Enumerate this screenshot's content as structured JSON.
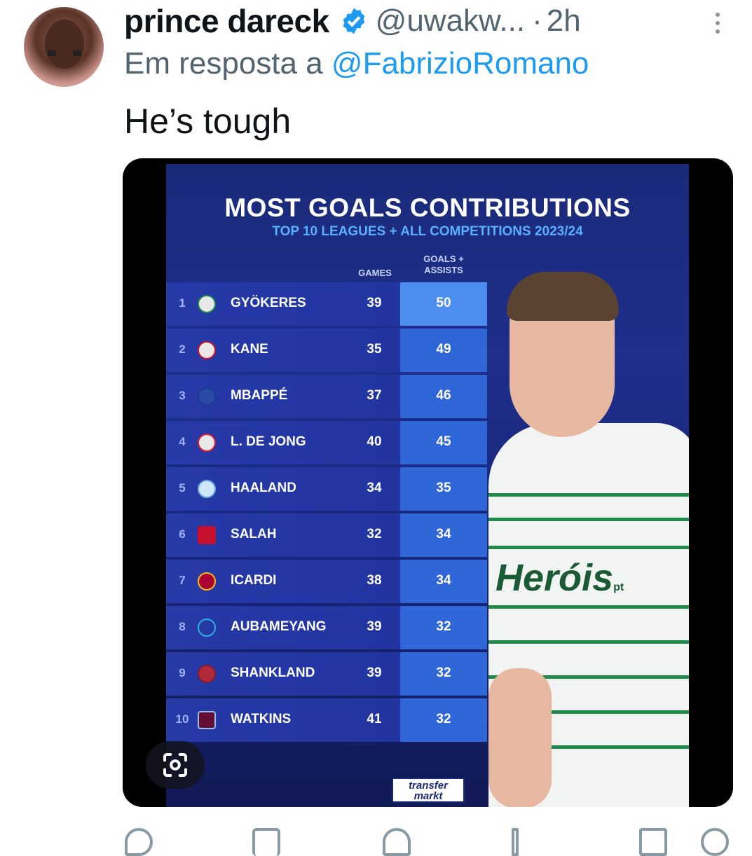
{
  "tweet": {
    "author_name": "prince dareck",
    "handle": "@uwakw...",
    "separator": "·",
    "time": "2h",
    "reply_prefix": "Em resposta a",
    "reply_to": "@FabrizioRomano",
    "text": "He’s tough"
  },
  "graphic": {
    "title": "MOST GOALS CONTRIBUTIONS",
    "subtitle": "TOP 10 LEAGUES + ALL COMPETITIONS 2023/24",
    "col_games": "GAMES",
    "col_goals_line1": "GOALS +",
    "col_goals_line2": "ASSISTS",
    "sponsor": "Heróis",
    "sponsor_suffix": "pt",
    "source_line1": "transfer",
    "source_line2": "markt",
    "rows": [
      {
        "rank": "1",
        "name": "GYÖKERES",
        "games": "39",
        "ga": "50",
        "crest": "sporting-crest"
      },
      {
        "rank": "2",
        "name": "KANE",
        "games": "35",
        "ga": "49",
        "crest": "bayern-crest"
      },
      {
        "rank": "3",
        "name": "MBAPPÉ",
        "games": "37",
        "ga": "46",
        "crest": "psg-crest"
      },
      {
        "rank": "4",
        "name": "L. DE JONG",
        "games": "40",
        "ga": "45",
        "crest": "psv-crest"
      },
      {
        "rank": "5",
        "name": "HAALAND",
        "games": "34",
        "ga": "35",
        "crest": "man-city-crest"
      },
      {
        "rank": "6",
        "name": "SALAH",
        "games": "32",
        "ga": "34",
        "crest": "liverpool-crest"
      },
      {
        "rank": "7",
        "name": "ICARDI",
        "games": "38",
        "ga": "34",
        "crest": "galatasaray-crest"
      },
      {
        "rank": "8",
        "name": "AUBAMEYANG",
        "games": "39",
        "ga": "32",
        "crest": "marseille-crest"
      },
      {
        "rank": "9",
        "name": "SHANKLAND",
        "games": "39",
        "ga": "32",
        "crest": "hearts-crest"
      },
      {
        "rank": "10",
        "name": "WATKINS",
        "games": "41",
        "ga": "32",
        "crest": "aston-villa-crest"
      }
    ]
  },
  "colors": {
    "accent": "#1d9bf0",
    "secondary_text": "#536471",
    "graphic_bg": "#1f2f8a",
    "goals_column": "#2f66d8"
  },
  "icons": [
    "verified-badge-icon",
    "more-options-icon",
    "visual-search-icon",
    "reply-icon",
    "retweet-icon",
    "like-icon",
    "views-icon",
    "bookmark-icon",
    "share-icon"
  ]
}
